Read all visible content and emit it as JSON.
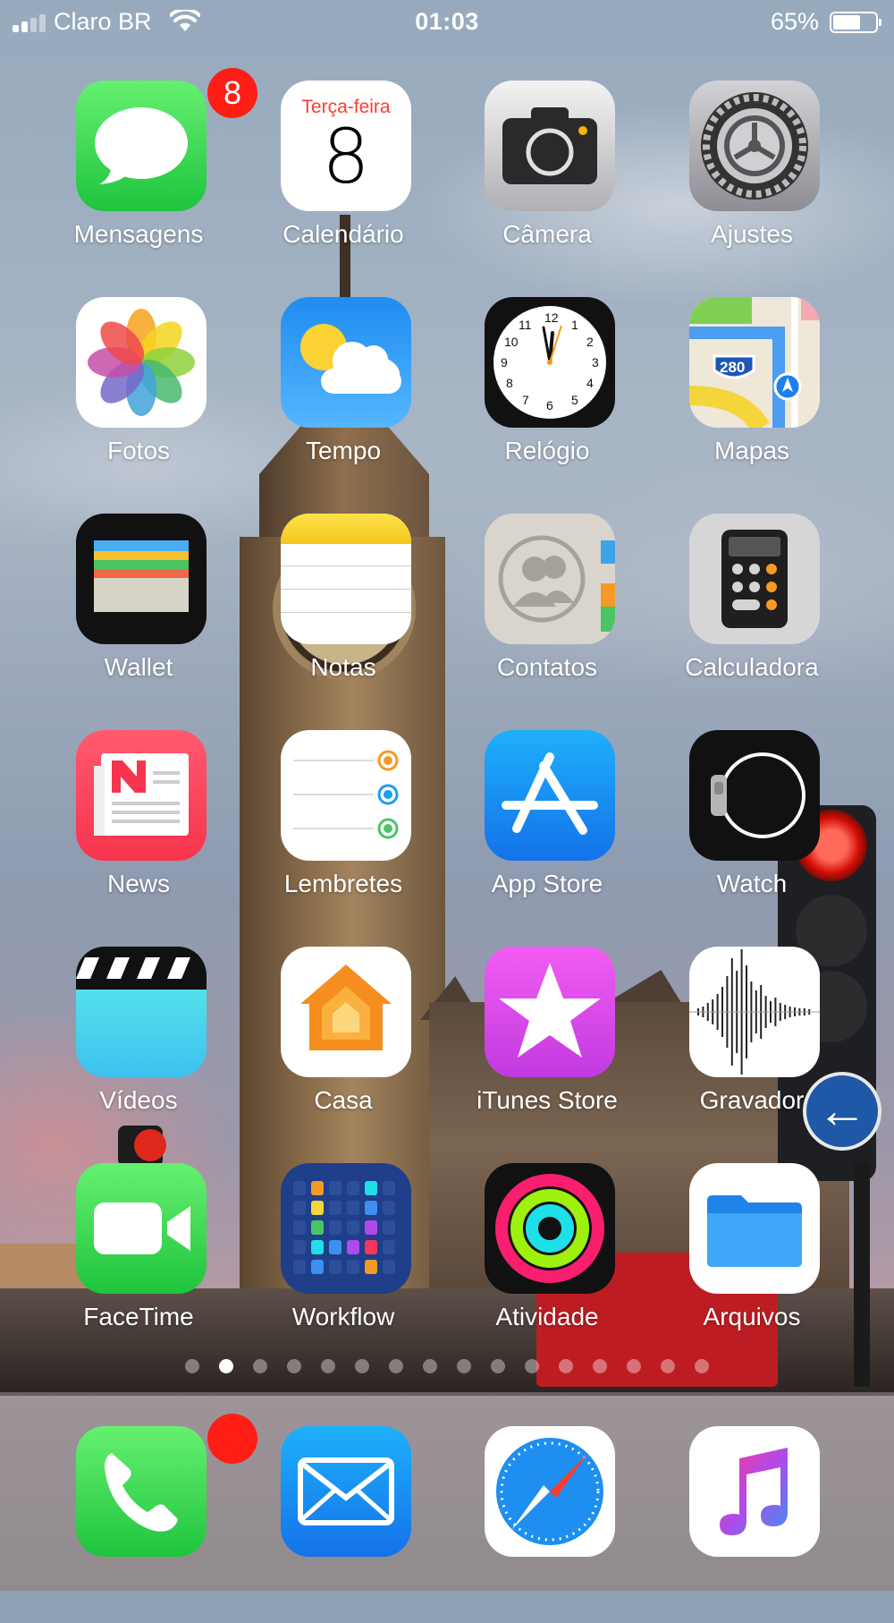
{
  "status_bar": {
    "carrier": "Claro BR",
    "time": "01:03",
    "battery_percent": "65%",
    "battery_level": 0.65,
    "signal_bars": 2
  },
  "apps": [
    {
      "label": "Mensagens",
      "icon": "messages-icon",
      "badge": "8"
    },
    {
      "label": "Calendário",
      "icon": "calendar-icon",
      "weekday": "Terça-feira",
      "day": "8"
    },
    {
      "label": "Câmera",
      "icon": "camera-icon"
    },
    {
      "label": "Ajustes",
      "icon": "settings-gear-icon"
    },
    {
      "label": "Fotos",
      "icon": "photos-icon"
    },
    {
      "label": "Tempo",
      "icon": "weather-icon"
    },
    {
      "label": "Relógio",
      "icon": "clock-icon"
    },
    {
      "label": "Mapas",
      "icon": "maps-icon",
      "shield": "280"
    },
    {
      "label": "Wallet",
      "icon": "wallet-icon"
    },
    {
      "label": "Notas",
      "icon": "notes-icon"
    },
    {
      "label": "Contatos",
      "icon": "contacts-icon"
    },
    {
      "label": "Calculadora",
      "icon": "calculator-icon"
    },
    {
      "label": "News",
      "icon": "news-icon"
    },
    {
      "label": "Lembretes",
      "icon": "reminders-icon"
    },
    {
      "label": "App Store",
      "icon": "app-store-icon"
    },
    {
      "label": "Watch",
      "icon": "watch-icon"
    },
    {
      "label": "Vídeos",
      "icon": "videos-icon"
    },
    {
      "label": "Casa",
      "icon": "home-icon"
    },
    {
      "label": "iTunes Store",
      "icon": "itunes-star-icon"
    },
    {
      "label": "Gravador",
      "icon": "voice-memos-icon"
    },
    {
      "label": "FaceTime",
      "icon": "facetime-icon"
    },
    {
      "label": "Workflow",
      "icon": "workflow-icon"
    },
    {
      "label": "Atividade",
      "icon": "activity-rings-icon"
    },
    {
      "label": "Arquivos",
      "icon": "files-folder-icon"
    }
  ],
  "page_indicator": {
    "total": 16,
    "current": 2
  },
  "dock": [
    {
      "icon": "phone-icon",
      "badge": ""
    },
    {
      "icon": "mail-icon"
    },
    {
      "icon": "safari-compass-icon"
    },
    {
      "icon": "music-note-icon"
    }
  ],
  "colors": {
    "badge_red": "#ff1e15",
    "messages_green": "#35d14c",
    "appstore_blue": "#1b8ff5"
  }
}
